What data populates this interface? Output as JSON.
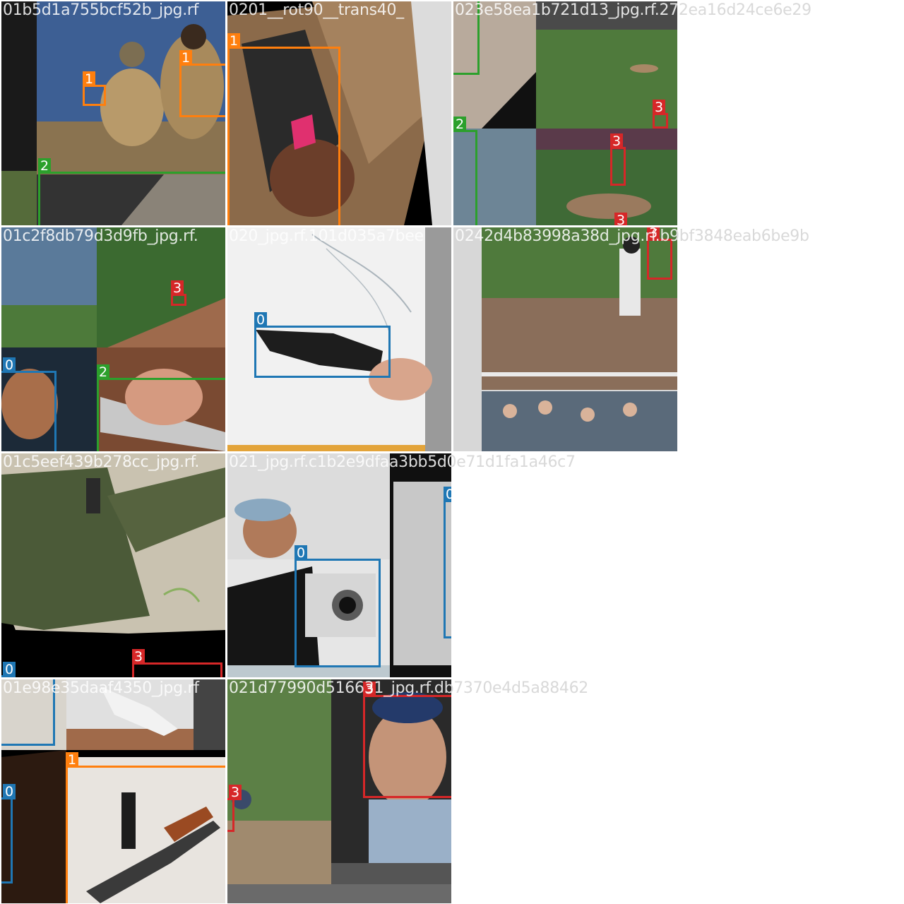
{
  "colors": {
    "class_0": "#1f77b4",
    "class_1": "#ff7f0e",
    "class_2": "#2ca02c",
    "class_3": "#d62728"
  },
  "tiles": [
    {
      "name": "01b5d1a755bcf52b_jpg.rf",
      "labels": [
        "1",
        "1",
        "2"
      ]
    },
    {
      "name": "0201__rot90__trans40_",
      "labels": [
        "1"
      ]
    },
    {
      "name": "023e58ea1b721d13_jpg.rf.272ea16d24ce6e29",
      "labels": [
        "2",
        "2",
        "3",
        "3",
        "3"
      ]
    },
    {
      "name": "01c2f8db79d3d9fb_jpg.rf.",
      "labels": [
        "3",
        "0",
        "2"
      ]
    },
    {
      "name": "020_jpg.rf.101d035a7bee",
      "labels": [
        "0"
      ]
    },
    {
      "name": "0242d4b83998a38d_jpg.rf.b9bf3848eab6be9b",
      "labels": [
        "3"
      ]
    },
    {
      "name": "01c5eef439b278cc_jpg.rf.",
      "labels": [
        "0",
        "3"
      ]
    },
    {
      "name": "021_jpg.rf.c1b2e9dfaa3bb5d0e71d1fa1a46c7",
      "labels": [
        "0",
        "0"
      ]
    },
    {
      "name": "01e98e35daaf4350_jpg.rf",
      "labels": [
        "1",
        "0"
      ]
    },
    {
      "name": "021d77990d516631_jpg.rf.db7370e4d5a88462",
      "labels": [
        "3",
        "3"
      ]
    }
  ]
}
